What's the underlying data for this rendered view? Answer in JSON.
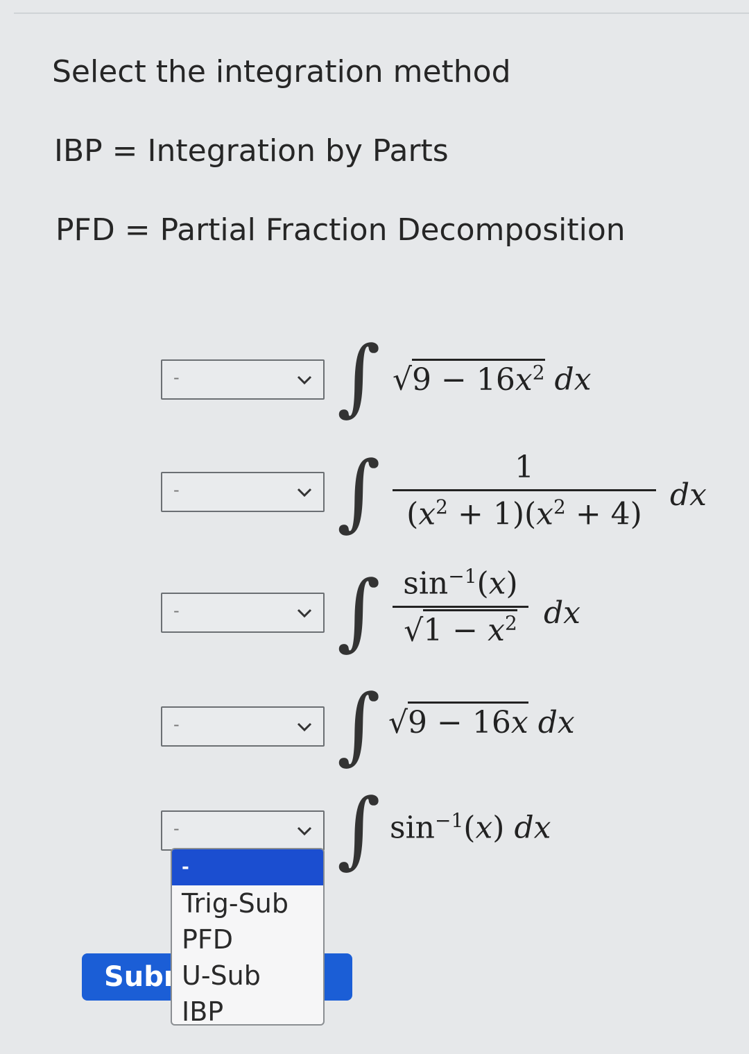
{
  "header": {
    "instruction": "Select the integration method",
    "legend_ibp": "IBP = Integration by Parts",
    "legend_pfd": "PFD = Partial Fraction Decomposition"
  },
  "problems": [
    {
      "selected": "-"
    },
    {
      "selected": "-"
    },
    {
      "selected": "-"
    },
    {
      "selected": "-"
    },
    {
      "selected": "-"
    }
  ],
  "dropdown_options": [
    "-",
    "Trig-Sub",
    "PFD",
    "U-Sub",
    "IBP"
  ],
  "submit": {
    "label": "Subm"
  },
  "colors": {
    "accent": "#1b5ed6",
    "selected_option": "#1b4ed0",
    "background": "#e6e8ea"
  },
  "icons": {
    "select_chevron": "chevron-down-icon",
    "integral": "integral-sign"
  }
}
